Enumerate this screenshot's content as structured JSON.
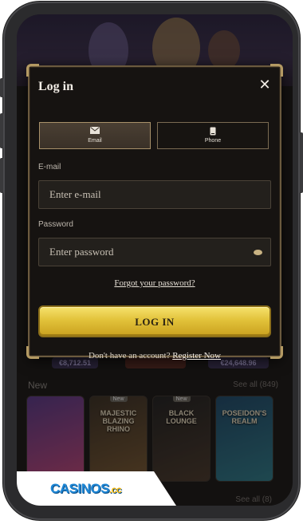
{
  "modal": {
    "title": "Log in",
    "close_icon": "close-icon",
    "tabs": [
      {
        "label": "Email",
        "icon": "envelope-icon",
        "active": true
      },
      {
        "label": "Phone",
        "icon": "phone-icon",
        "active": false
      }
    ],
    "email": {
      "label": "E-mail",
      "placeholder": "Enter e-mail",
      "value": ""
    },
    "password": {
      "label": "Password",
      "placeholder": "Enter password",
      "value": "",
      "toggle_icon": "eye-icon"
    },
    "forgot_label": "Forgot your password?",
    "login_label": "LOG IN",
    "register_prompt": "Don't have an account?",
    "register_link": "Register Now"
  },
  "background": {
    "prices": [
      "€8,712.51",
      "€24,648.96"
    ],
    "section_title": "New",
    "see_all": "See all (849)",
    "see_all_bottom": "See all (8)",
    "games": [
      {
        "title": "",
        "badge": ""
      },
      {
        "title": "MAJESTIC BLAZING RHINO",
        "badge": "New"
      },
      {
        "title": "BLACK LOUNGE",
        "badge": "New"
      },
      {
        "title": "POSEIDON'S REALM",
        "badge": ""
      }
    ]
  },
  "brand": {
    "name": "CASINOS",
    "suffix": ".cc"
  },
  "colors": {
    "accent_gold": "#e2c23a",
    "frame": "#6b5a3e",
    "brand_blue": "#1e87d6"
  }
}
